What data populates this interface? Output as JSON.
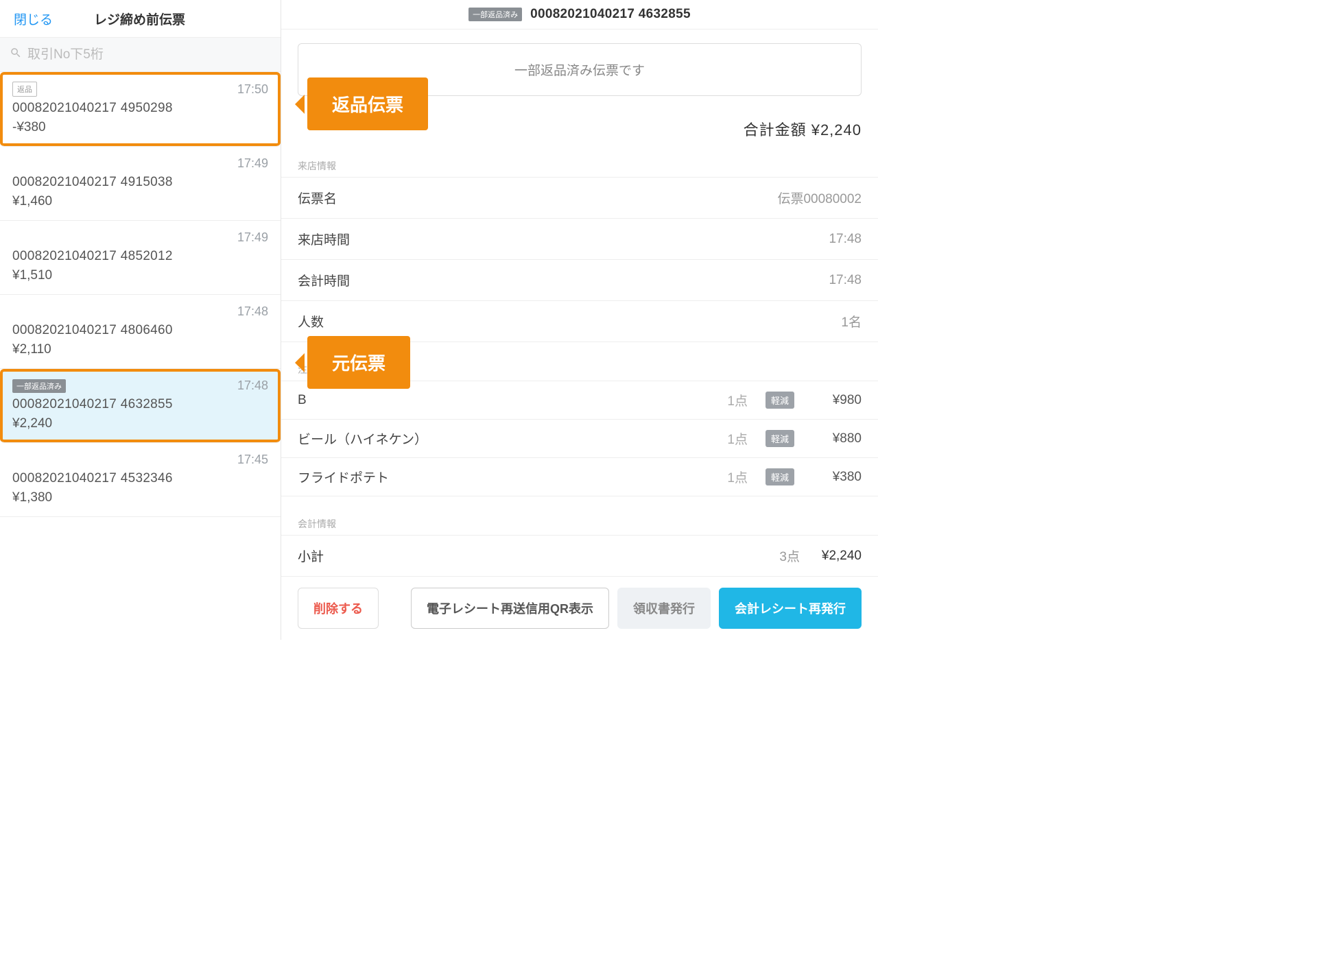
{
  "left": {
    "close": "閉じる",
    "title": "レジ締め前伝票",
    "search_placeholder": "取引No下5桁",
    "items": [
      {
        "tag": "返品",
        "tag_style": "outline",
        "time": "17:50",
        "id": "00082021040217 4950298",
        "amount": "-¥380",
        "highlight": true
      },
      {
        "tag": "",
        "tag_style": "",
        "time": "17:49",
        "id": "00082021040217 4915038",
        "amount": "¥1,460"
      },
      {
        "tag": "",
        "tag_style": "",
        "time": "17:49",
        "id": "00082021040217 4852012",
        "amount": "¥1,510"
      },
      {
        "tag": "",
        "tag_style": "",
        "time": "17:48",
        "id": "00082021040217 4806460",
        "amount": "¥2,110"
      },
      {
        "tag": "一部返品済み",
        "tag_style": "filled",
        "time": "17:48",
        "id": "00082021040217 4632855",
        "amount": "¥2,240",
        "selected": true,
        "highlight": true
      },
      {
        "tag": "",
        "tag_style": "",
        "time": "17:45",
        "id": "00082021040217 4532346",
        "amount": "¥1,380"
      }
    ]
  },
  "right": {
    "header_tag": "一部返品済み",
    "header_id": "00082021040217 4632855",
    "notice": "一部返品済み伝票です",
    "sum_label": "合計金額",
    "sum_value": "¥2,240",
    "section_visit": "来店情報",
    "kv": [
      {
        "k": "伝票名",
        "v": "伝票00080002"
      },
      {
        "k": "来店時間",
        "v": "17:48"
      },
      {
        "k": "会計時間",
        "v": "17:48"
      },
      {
        "k": "人数",
        "v": "1名"
      }
    ],
    "section_order_hint": "注",
    "orders": [
      {
        "name": "B",
        "qty": "1点",
        "tax": "軽減",
        "price": "¥980"
      },
      {
        "name": "ビール（ハイネケン）",
        "qty": "1点",
        "tax": "軽減",
        "price": "¥880"
      },
      {
        "name": "フライドポテト",
        "qty": "1点",
        "tax": "軽減",
        "price": "¥380"
      }
    ],
    "section_payment": "会計情報",
    "subtotal_label": "小計",
    "subtotal_qty": "3点",
    "subtotal_price": "¥2,240",
    "buttons": {
      "delete": "削除する",
      "qr": "電子レシート再送信用QR表示",
      "receipt": "領収書発行",
      "reprint": "会計レシート再発行"
    }
  },
  "callouts": {
    "return_slip": "返品伝票",
    "source_slip": "元伝票"
  }
}
